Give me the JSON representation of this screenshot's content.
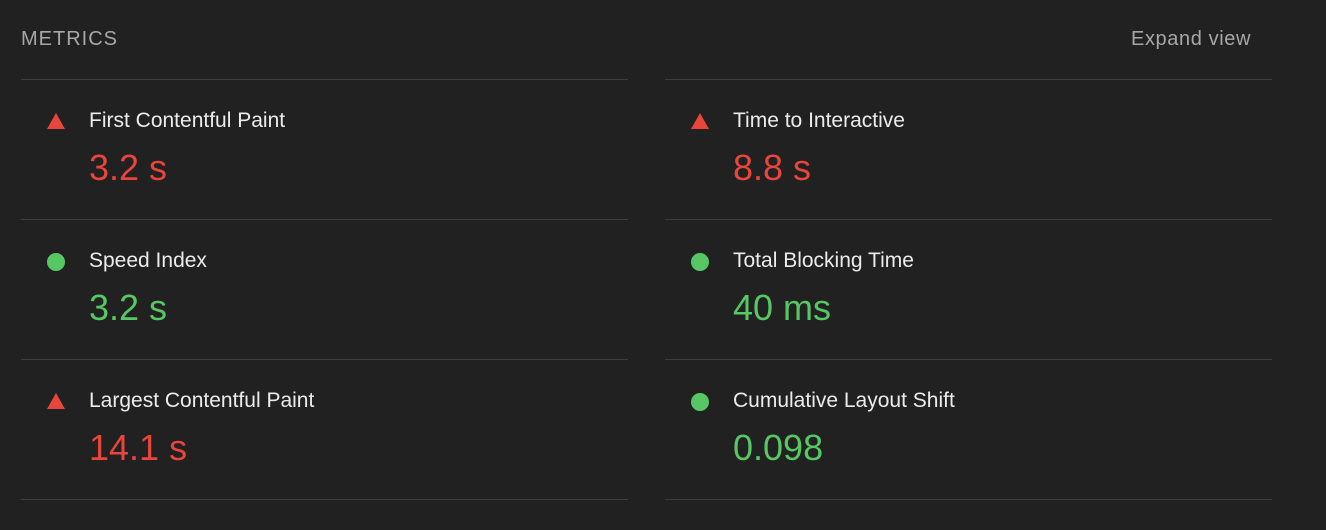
{
  "header": {
    "title": "METRICS",
    "expand_label": "Expand view"
  },
  "colors": {
    "fail": "#e8453c",
    "pass": "#57c764",
    "background": "#212121",
    "divider": "#3d3d3d"
  },
  "metrics": [
    {
      "label": "First Contentful Paint",
      "value": "3.2 s",
      "status": "fail",
      "icon": "triangle-fail-icon"
    },
    {
      "label": "Time to Interactive",
      "value": "8.8 s",
      "status": "fail",
      "icon": "triangle-fail-icon"
    },
    {
      "label": "Speed Index",
      "value": "3.2 s",
      "status": "pass",
      "icon": "circle-pass-icon"
    },
    {
      "label": "Total Blocking Time",
      "value": "40 ms",
      "status": "pass",
      "icon": "circle-pass-icon"
    },
    {
      "label": "Largest Contentful Paint",
      "value": "14.1 s",
      "status": "fail",
      "icon": "triangle-fail-icon"
    },
    {
      "label": "Cumulative Layout Shift",
      "value": "0.098",
      "status": "pass",
      "icon": "circle-pass-icon"
    }
  ]
}
